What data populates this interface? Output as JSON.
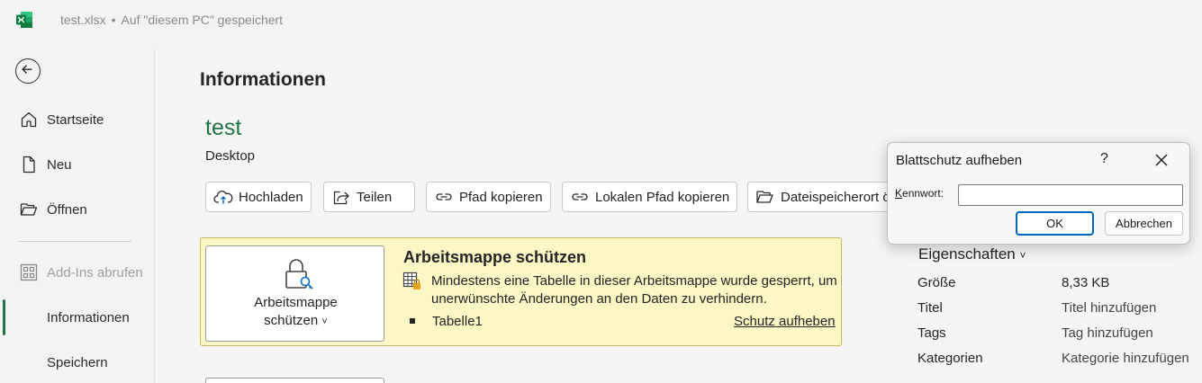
{
  "titlebar": {
    "filename": "test.xlsx",
    "separator": "•",
    "save_status": "Auf \"diesem PC\" gespeichert",
    "app_icon": "excel-icon"
  },
  "sidebar": {
    "back_icon": "back-arrow-icon",
    "items": [
      {
        "label": "Startseite",
        "icon": "home-icon"
      },
      {
        "label": "Neu",
        "icon": "new-document-icon"
      },
      {
        "label": "Öffnen",
        "icon": "open-folder-icon"
      },
      {
        "label": "Add-Ins abrufen",
        "icon": "add-ins-icon"
      },
      {
        "label": "Informationen"
      },
      {
        "label": "Speichern"
      }
    ],
    "selected": "Informationen",
    "accent_color": "#217346"
  },
  "main": {
    "page_title": "Informationen",
    "doc_name": "test",
    "doc_location": "Desktop",
    "actions": [
      {
        "label": "Hochladen",
        "icon": "upload-icon"
      },
      {
        "label": "Teilen",
        "icon": "share-icon"
      },
      {
        "label": "Pfad kopieren",
        "icon": "link-icon"
      },
      {
        "label": "Lokalen Pfad kopieren",
        "icon": "link-icon"
      },
      {
        "label": "Dateispeicherort ö",
        "icon": "folder-open-icon"
      }
    ],
    "protect": {
      "button_line1": "Arbeitsmappe",
      "button_line2": "schützen",
      "chevron": "˅",
      "heading": "Arbeitsmappe schützen",
      "message": "Mindestens eine Tabelle in dieser Arbeitsmappe wurde gesperrt, um unerwünschte Änderungen an den Daten zu verhindern.",
      "sheet": "Tabelle1",
      "unprotect_link": "Schutz aufheben",
      "panel_color": "#fdf6c5"
    },
    "properties": {
      "heading": "Eigenschaften",
      "chevron": "˅",
      "rows": [
        {
          "label": "Größe",
          "value": "8,33 KB"
        },
        {
          "label": "Titel",
          "value": "Titel hinzufügen"
        },
        {
          "label": "Tags",
          "value": "Tag hinzufügen"
        },
        {
          "label": "Kategorien",
          "value": "Kategorie hinzufügen"
        }
      ]
    }
  },
  "dialog": {
    "title": "Blattschutz aufheben",
    "help": "?",
    "password_label_accel": "K",
    "password_label_rest": "ennwort:",
    "password_value": "",
    "ok_label": "OK",
    "cancel_label": "Abbrechen"
  }
}
